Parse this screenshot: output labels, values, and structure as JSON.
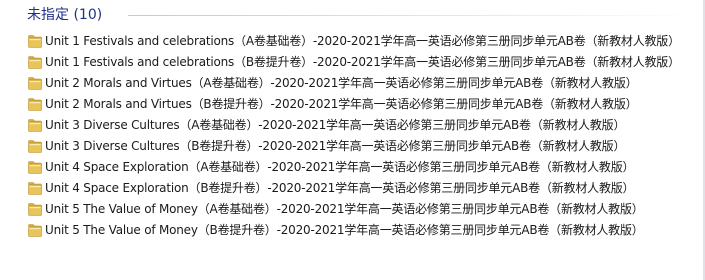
{
  "group": {
    "title": "未指定 (10)"
  },
  "items": [
    {
      "name": "Unit 1 Festivals and celebrations（A卷基础卷）-2020-2021学年高一英语必修第三册同步单元AB卷（新教材人教版）"
    },
    {
      "name": "Unit 1 Festivals and celebrations（B卷提升卷）-2020-2021学年高一英语必修第三册同步单元AB卷（新教材人教版）"
    },
    {
      "name": "Unit 2 Morals and Virtues（A卷基础卷）-2020-2021学年高一英语必修第三册同步单元AB卷（新教材人教版）"
    },
    {
      "name": "Unit 2 Morals and Virtues（B卷提升卷）-2020-2021学年高一英语必修第三册同步单元AB卷（新教材人教版）"
    },
    {
      "name": "Unit 3 Diverse Cultures（A卷基础卷）-2020-2021学年高一英语必修第三册同步单元AB卷（新教材人教版）"
    },
    {
      "name": "Unit 3 Diverse Cultures（B卷提升卷）-2020-2021学年高一英语必修第三册同步单元AB卷（新教材人教版）"
    },
    {
      "name": "Unit 4 Space Exploration（A卷基础卷）-2020-2021学年高一英语必修第三册同步单元AB卷（新教材人教版）"
    },
    {
      "name": "Unit 4 Space Exploration（B卷提升卷）-2020-2021学年高一英语必修第三册同步单元AB卷（新教材人教版）"
    },
    {
      "name": "Unit 5 The Value of Money（A卷基础卷）-2020-2021学年高一英语必修第三册同步单元AB卷（新教材人教版）"
    },
    {
      "name": "Unit 5 The Value of Money（B卷提升卷）-2020-2021学年高一英语必修第三册同步单元AB卷（新教材人教版）"
    }
  ],
  "colors": {
    "group_title": "#1e3287",
    "folder_body": "#e8c55a",
    "folder_tab": "#d9b03f"
  },
  "icons": {
    "item": "folder-icon"
  }
}
